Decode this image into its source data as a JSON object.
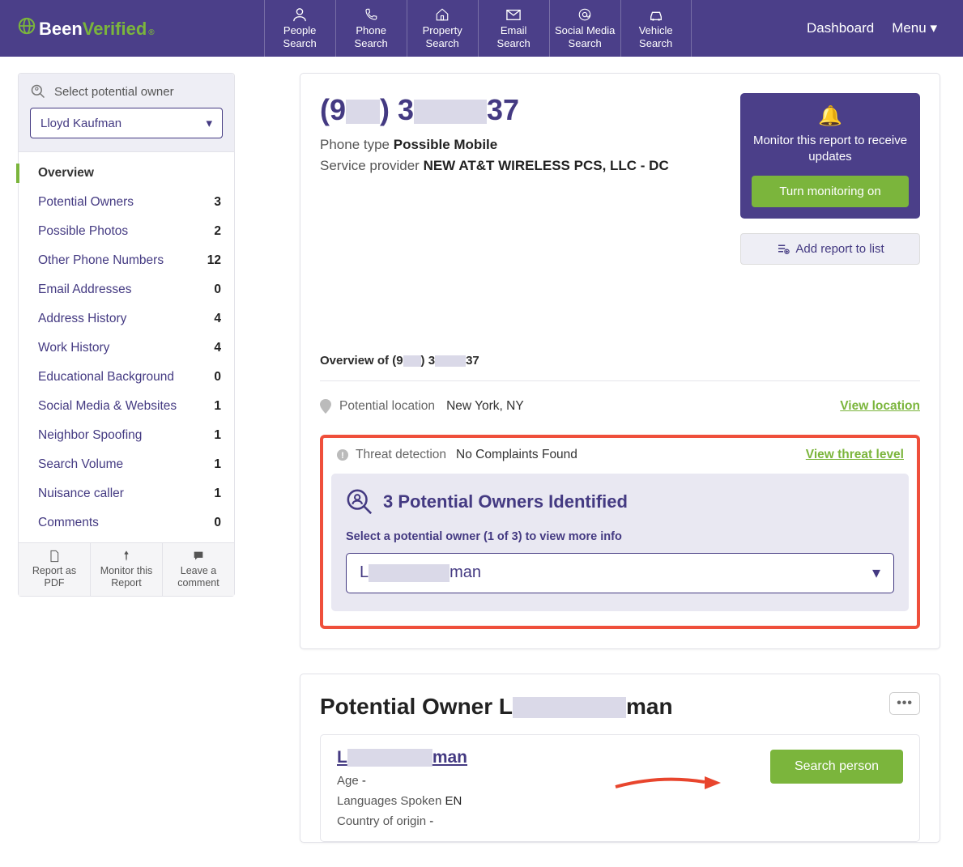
{
  "header": {
    "logo": {
      "been": "Been",
      "verified": "Verified",
      "reg": "®"
    },
    "nav": [
      {
        "line1": "People",
        "line2": "Search"
      },
      {
        "line1": "Phone",
        "line2": "Search"
      },
      {
        "line1": "Property",
        "line2": "Search"
      },
      {
        "line1": "Email",
        "line2": "Search"
      },
      {
        "line1": "Social Media",
        "line2": "Search"
      },
      {
        "line1": "Vehicle",
        "line2": "Search"
      }
    ],
    "dashboard": "Dashboard",
    "menu": "Menu"
  },
  "sidebar": {
    "select_title": "Select potential owner",
    "selected": "Lloyd Kaufman",
    "items": [
      {
        "label": "Overview",
        "count": ""
      },
      {
        "label": "Potential Owners",
        "count": "3"
      },
      {
        "label": "Possible Photos",
        "count": "2"
      },
      {
        "label": "Other Phone Numbers",
        "count": "12"
      },
      {
        "label": "Email Addresses",
        "count": "0"
      },
      {
        "label": "Address History",
        "count": "4"
      },
      {
        "label": "Work History",
        "count": "4"
      },
      {
        "label": "Educational Background",
        "count": "0"
      },
      {
        "label": "Social Media & Websites",
        "count": "1"
      },
      {
        "label": "Neighbor Spoofing",
        "count": "1"
      },
      {
        "label": "Search Volume",
        "count": "1"
      },
      {
        "label": "Nuisance caller",
        "count": "1"
      },
      {
        "label": "Comments",
        "count": "0"
      }
    ],
    "actions": {
      "pdf": "Report as PDF",
      "monitor": "Monitor this Report",
      "comment": "Leave a comment"
    }
  },
  "report": {
    "phone_open": "(9",
    "phone_mid": ") 3",
    "phone_end": "37",
    "phone_type_label": "Phone type ",
    "phone_type": "Possible Mobile",
    "provider_label": "Service provider ",
    "provider": "NEW AT&T WIRELESS PCS, LLC - DC",
    "monitor": {
      "text": "Monitor this report to receive updates",
      "button": "Turn monitoring on"
    },
    "add_list": "Add report to list",
    "overview_prefix": "Overview of (9",
    "overview_mid": ") 3",
    "overview_end": "37",
    "location": {
      "label": "Potential location",
      "value": "New York, NY",
      "link": "View location"
    },
    "threat": {
      "label": "Threat detection",
      "value": "No Complaints Found",
      "link": "View threat level"
    },
    "owners": {
      "title": "3 Potential Owners Identified",
      "sub": "Select a potential owner (1 of 3) to view more info",
      "selected_prefix": "L",
      "selected_suffix": "man"
    },
    "po": {
      "heading_prefix": "Potential Owner L",
      "heading_suffix": "man",
      "name_prefix": "L",
      "name_suffix": "man",
      "age_label": "Age ",
      "age": "-",
      "lang_label": "Languages Spoken ",
      "lang": "EN",
      "origin_label": "Country of origin ",
      "origin": "-",
      "search_btn": "Search person"
    }
  }
}
